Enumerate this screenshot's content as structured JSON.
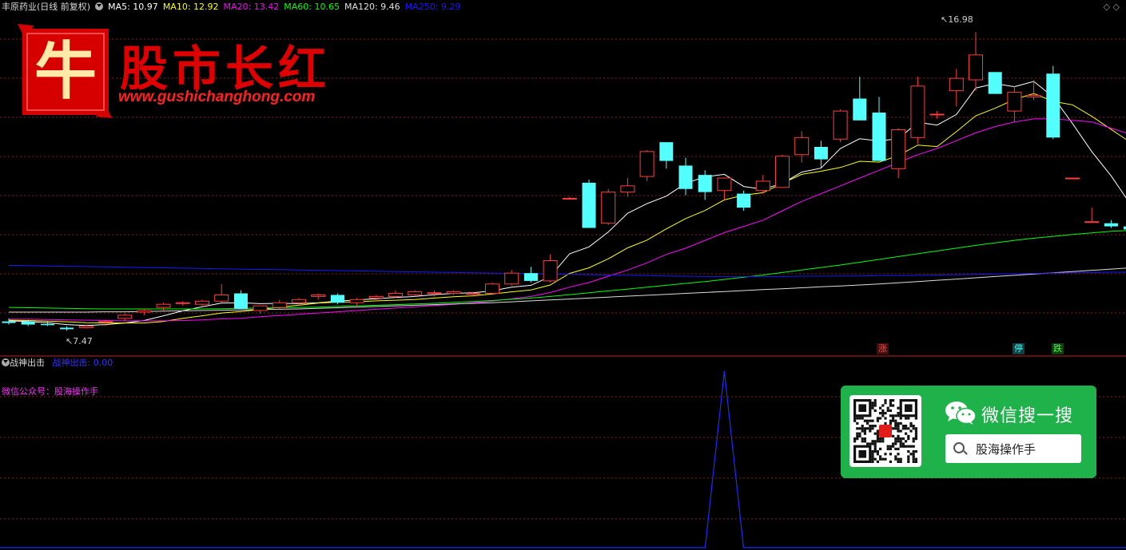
{
  "header": {
    "title": "丰原药业(日线 前复权)",
    "indicators": [
      {
        "label": "MA5: 10.97",
        "color": "#ffffff"
      },
      {
        "label": "MA10: 12.92",
        "color": "#ffff00"
      },
      {
        "label": "MA20: 13.42",
        "color": "#ff00ff"
      },
      {
        "label": "MA60: 10.65",
        "color": "#00ff00"
      },
      {
        "label": "MA120: 9.46",
        "color": "#e0e0e0"
      },
      {
        "label": "MA250: 9.29",
        "color": "#1818ff"
      }
    ],
    "window_controls": "◇ ◇"
  },
  "logo": {
    "emblem_char": "牛",
    "name": "股市长红",
    "site": "www.gushichanghong.com"
  },
  "annotations": {
    "high": "16.98",
    "low": "7.47"
  },
  "markers": [
    {
      "char": "涨",
      "color": "#ff4040",
      "bg": "#401010"
    },
    {
      "char": "停",
      "color": "#40ffff",
      "bg": "#104040"
    },
    {
      "char": "跌",
      "color": "#40ff40",
      "bg": "#104010"
    }
  ],
  "sub_panel": {
    "name": "战神出击",
    "value_label": "战神出击: 0.00",
    "wechat_label": "微信公众号：股海操作手"
  },
  "wechat_card": {
    "title": "微信搜一搜",
    "search_text": "股海操作手"
  },
  "chart_data": {
    "type": "candlestick",
    "ylim": [
      7.0,
      17.5
    ],
    "candles": [
      [
        7.7,
        7.8,
        7.6,
        7.65
      ],
      [
        7.7,
        7.75,
        7.55,
        7.6
      ],
      [
        7.62,
        7.7,
        7.55,
        7.58
      ],
      [
        7.5,
        7.55,
        7.4,
        7.45
      ],
      [
        7.5,
        7.6,
        7.47,
        7.55
      ],
      [
        7.7,
        7.75,
        7.55,
        7.7
      ],
      [
        7.8,
        7.95,
        7.7,
        7.9
      ],
      [
        8.0,
        8.1,
        7.9,
        8.05
      ],
      [
        8.15,
        8.3,
        8.05,
        8.25
      ],
      [
        8.3,
        8.35,
        8.2,
        8.3
      ],
      [
        8.25,
        8.4,
        8.2,
        8.35
      ],
      [
        8.35,
        8.9,
        8.3,
        8.55
      ],
      [
        8.6,
        8.7,
        8.1,
        8.1
      ],
      [
        8.05,
        8.2,
        7.95,
        8.2
      ],
      [
        8.15,
        8.4,
        8.1,
        8.3
      ],
      [
        8.3,
        8.45,
        8.2,
        8.4
      ],
      [
        8.5,
        8.6,
        8.4,
        8.55
      ],
      [
        8.55,
        8.6,
        8.25,
        8.3
      ],
      [
        8.3,
        8.45,
        8.2,
        8.4
      ],
      [
        8.45,
        8.55,
        8.35,
        8.5
      ],
      [
        8.5,
        8.7,
        8.45,
        8.6
      ],
      [
        8.55,
        8.7,
        8.5,
        8.65
      ],
      [
        8.6,
        8.7,
        8.5,
        8.62
      ],
      [
        8.6,
        8.7,
        8.55,
        8.65
      ],
      [
        8.6,
        8.65,
        8.5,
        8.6
      ],
      [
        8.6,
        8.95,
        8.55,
        8.9
      ],
      [
        8.9,
        9.35,
        8.85,
        9.25
      ],
      [
        9.25,
        9.45,
        8.95,
        9.0
      ],
      [
        9.0,
        9.85,
        8.95,
        9.65
      ],
      [
        11.65,
        11.7,
        11.6,
        11.65
      ],
      [
        12.15,
        12.25,
        10.7,
        10.7
      ],
      [
        10.85,
        11.95,
        10.8,
        11.85
      ],
      [
        11.85,
        12.3,
        11.7,
        12.05
      ],
      [
        12.35,
        13.2,
        12.2,
        13.15
      ],
      [
        13.45,
        13.45,
        12.6,
        12.85
      ],
      [
        12.7,
        12.95,
        11.75,
        11.95
      ],
      [
        12.4,
        12.55,
        11.6,
        11.85
      ],
      [
        11.9,
        12.3,
        11.6,
        12.3
      ],
      [
        11.8,
        11.9,
        11.25,
        11.35
      ],
      [
        11.9,
        12.4,
        11.8,
        12.2
      ],
      [
        12.0,
        13.05,
        12.0,
        13.0
      ],
      [
        13.05,
        13.8,
        12.8,
        13.6
      ],
      [
        13.3,
        13.5,
        12.6,
        12.9
      ],
      [
        13.55,
        14.5,
        13.45,
        14.45
      ],
      [
        14.85,
        15.55,
        14.15,
        14.15
      ],
      [
        14.4,
        14.9,
        12.85,
        12.85
      ],
      [
        12.6,
        13.9,
        12.3,
        13.85
      ],
      [
        13.6,
        15.55,
        13.4,
        15.25
      ],
      [
        14.35,
        14.45,
        14.2,
        14.35
      ],
      [
        15.1,
        15.8,
        14.6,
        15.5
      ],
      [
        15.45,
        16.98,
        15.1,
        16.25
      ],
      [
        15.7,
        15.7,
        15.0,
        15.0
      ],
      [
        14.45,
        15.25,
        14.1,
        15.05
      ],
      [
        14.9,
        15.45,
        14.8,
        14.95
      ],
      [
        15.65,
        15.9,
        13.55,
        13.6
      ],
      [
        12.3,
        12.3,
        12.3,
        12.3
      ],
      [
        10.9,
        11.35,
        10.9,
        10.9
      ],
      [
        10.85,
        10.95,
        10.7,
        10.75
      ],
      [
        10.75,
        10.8,
        10.55,
        10.65
      ],
      [
        10.65,
        10.65,
        10.35,
        10.5
      ]
    ],
    "ma": [
      {
        "name": "MA5",
        "color": "#ffffff",
        "values": [
          7.72,
          7.7,
          7.66,
          7.6,
          7.57,
          7.6,
          7.65,
          7.73,
          7.88,
          8.04,
          8.17,
          8.29,
          8.3,
          8.27,
          8.28,
          8.27,
          8.3,
          8.35,
          8.39,
          8.43,
          8.47,
          8.5,
          8.56,
          8.6,
          8.62,
          8.68,
          8.8,
          8.86,
          9.14,
          9.87,
          10.09,
          10.57,
          11.17,
          11.48,
          11.72,
          12.13,
          12.34,
          12.42,
          12.03,
          11.94,
          12.13,
          12.49,
          12.62,
          13.25,
          13.56,
          13.49,
          13.56,
          14.09,
          14.0,
          14.34,
          15.19,
          15.33,
          15.23,
          15.4,
          14.9,
          14.05,
          13.15,
          12.37,
          11.46,
          10.94
        ]
      },
      {
        "name": "MA10",
        "color": "#ffff00",
        "values": [
          7.74,
          7.73,
          7.71,
          7.69,
          7.66,
          7.65,
          7.65,
          7.65,
          7.7,
          7.8,
          7.88,
          7.97,
          8.02,
          8.08,
          8.16,
          8.22,
          8.29,
          8.32,
          8.33,
          8.36,
          8.38,
          8.4,
          8.45,
          8.49,
          8.52,
          8.58,
          8.65,
          8.71,
          8.87,
          9.24,
          9.42,
          9.71,
          10.06,
          10.31,
          10.67,
          11.0,
          11.26,
          11.6,
          11.75,
          11.83,
          12.13,
          12.42,
          12.52,
          12.64,
          12.84,
          12.81,
          13.02,
          13.36,
          13.31,
          13.79,
          14.3,
          14.54,
          14.82,
          15.01,
          14.76,
          14.65,
          14.28,
          13.86,
          13.44,
          12.92
        ]
      },
      {
        "name": "MA20",
        "color": "#ff00ff",
        "values": [
          7.77,
          7.77,
          7.76,
          7.75,
          7.74,
          7.73,
          7.72,
          7.72,
          7.72,
          7.73,
          7.75,
          7.78,
          7.8,
          7.85,
          7.89,
          7.93,
          7.97,
          8.01,
          8.05,
          8.09,
          8.13,
          8.17,
          8.21,
          8.25,
          8.3,
          8.35,
          8.43,
          8.5,
          8.63,
          8.8,
          8.95,
          9.15,
          9.35,
          9.58,
          9.85,
          10.05,
          10.3,
          10.55,
          10.75,
          10.95,
          11.25,
          11.55,
          11.8,
          12.05,
          12.3,
          12.55,
          12.8,
          13.05,
          13.25,
          13.5,
          13.75,
          13.95,
          14.1,
          14.2,
          14.2,
          14.15,
          14.1,
          13.9,
          13.7,
          13.42
        ]
      },
      {
        "name": "MA60",
        "color": "#00ff00",
        "values": [
          8.15,
          8.14,
          8.13,
          8.12,
          8.11,
          8.1,
          8.1,
          8.1,
          8.1,
          8.1,
          8.1,
          8.11,
          8.12,
          8.13,
          8.14,
          8.15,
          8.16,
          8.18,
          8.2,
          8.22,
          8.24,
          8.26,
          8.28,
          8.31,
          8.34,
          8.37,
          8.41,
          8.45,
          8.5,
          8.56,
          8.62,
          8.68,
          8.74,
          8.8,
          8.86,
          8.92,
          8.98,
          9.05,
          9.12,
          9.19,
          9.27,
          9.35,
          9.43,
          9.51,
          9.6,
          9.69,
          9.78,
          9.87,
          9.96,
          10.05,
          10.14,
          10.22,
          10.3,
          10.37,
          10.43,
          10.49,
          10.54,
          10.59,
          10.62,
          10.65
        ]
      },
      {
        "name": "MA120",
        "color": "#dcdcdc",
        "values": [
          8.0,
          8.0,
          8.0,
          8.0,
          8.0,
          8.01,
          8.01,
          8.02,
          8.03,
          8.04,
          8.05,
          8.06,
          8.07,
          8.08,
          8.09,
          8.1,
          8.12,
          8.14,
          8.16,
          8.18,
          8.2,
          8.22,
          8.24,
          8.26,
          8.28,
          8.3,
          8.33,
          8.36,
          8.39,
          8.42,
          8.45,
          8.48,
          8.51,
          8.54,
          8.57,
          8.6,
          8.63,
          8.66,
          8.69,
          8.72,
          8.75,
          8.78,
          8.81,
          8.84,
          8.87,
          8.9,
          8.94,
          8.98,
          9.02,
          9.06,
          9.1,
          9.14,
          9.18,
          9.22,
          9.26,
          9.3,
          9.34,
          9.38,
          9.42,
          9.46
        ]
      },
      {
        "name": "MA250",
        "color": "#1818ff",
        "values": [
          9.5,
          9.49,
          9.48,
          9.47,
          9.46,
          9.45,
          9.44,
          9.43,
          9.42,
          9.41,
          9.4,
          9.39,
          9.38,
          9.37,
          9.36,
          9.35,
          9.34,
          9.33,
          9.32,
          9.31,
          9.3,
          9.29,
          9.28,
          9.27,
          9.26,
          9.25,
          9.24,
          9.23,
          9.22,
          9.21,
          9.2,
          9.19,
          9.18,
          9.17,
          9.16,
          9.15,
          9.14,
          9.14,
          9.14,
          9.14,
          9.14,
          9.15,
          9.15,
          9.16,
          9.16,
          9.17,
          9.17,
          9.18,
          9.19,
          9.2,
          9.21,
          9.22,
          9.23,
          9.24,
          9.25,
          9.26,
          9.27,
          9.28,
          9.28,
          9.29
        ]
      }
    ],
    "indicator": {
      "name": "战神出击",
      "spike_at": 37,
      "spike_value": 1.0,
      "baseline": 0
    }
  }
}
